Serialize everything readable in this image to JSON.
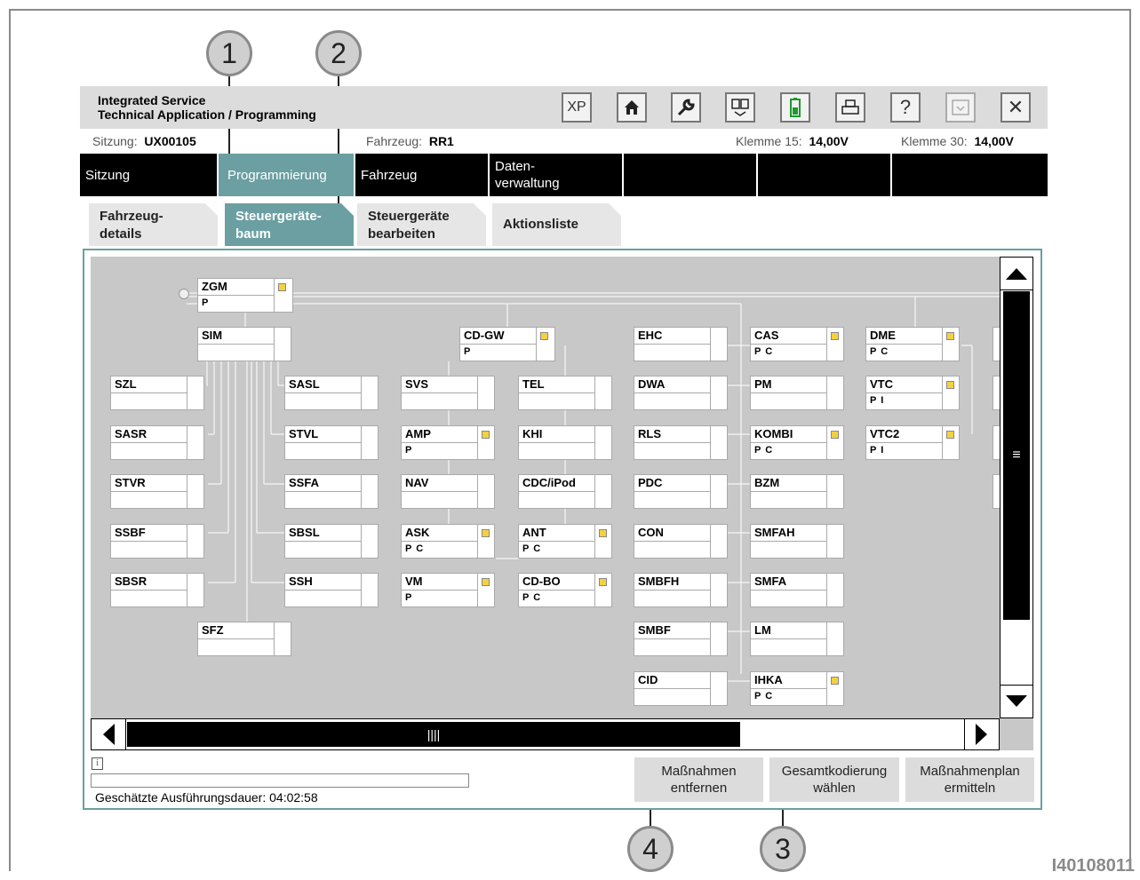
{
  "callouts": [
    "1",
    "2",
    "3",
    "4"
  ],
  "figure_id": "I40108011",
  "app": {
    "title": "Integrated Service\nTechnical Application / Programming",
    "toolbar": [
      {
        "name": "xp-button",
        "label": "XP",
        "icon": "xp-text"
      },
      {
        "name": "home-button",
        "label": "",
        "icon": "home-icon"
      },
      {
        "name": "wrench-button",
        "label": "",
        "icon": "wrench-icon"
      },
      {
        "name": "vehicle-data-button",
        "label": "",
        "icon": "data-exchange-icon"
      },
      {
        "name": "battery-button",
        "label": "",
        "icon": "battery-icon"
      },
      {
        "name": "print-button",
        "label": "",
        "icon": "printer-icon"
      },
      {
        "name": "help-button",
        "label": "?",
        "icon": "help-icon"
      },
      {
        "name": "minimize-button",
        "label": "",
        "icon": "minimize-icon"
      },
      {
        "name": "close-button",
        "label": "✕",
        "icon": "close-icon"
      }
    ]
  },
  "infobar": {
    "session_label": "Sitzung:",
    "session_value": "UX00105",
    "vehicle_label": "Fahrzeug:",
    "vehicle_value": "RR1",
    "k15_label": "Klemme 15:",
    "k15_value": "14,00V",
    "k30_label": "Klemme 30:",
    "k30_value": "14,00V"
  },
  "main_nav": [
    "Sitzung",
    "Programmierung",
    "Fahrzeug",
    "Daten-\nverwaltung",
    "",
    "",
    ""
  ],
  "sub_tabs": [
    "Fahrzeug-\ndetails",
    "Steuergeräte-\nbaum",
    "Steuergeräte\nbearbeiten",
    "Aktionsliste"
  ],
  "ecus": {
    "zgm": {
      "name": "ZGM",
      "action": "P"
    },
    "sim": {
      "name": "SIM",
      "action": ""
    },
    "szl": {
      "name": "SZL",
      "action": ""
    },
    "sasr": {
      "name": "SASR",
      "action": ""
    },
    "stvr": {
      "name": "STVR",
      "action": ""
    },
    "ssbf": {
      "name": "SSBF",
      "action": ""
    },
    "sbsr": {
      "name": "SBSR",
      "action": ""
    },
    "sfz": {
      "name": "SFZ",
      "action": ""
    },
    "sasl": {
      "name": "SASL",
      "action": ""
    },
    "stvl": {
      "name": "STVL",
      "action": ""
    },
    "ssfa": {
      "name": "SSFA",
      "action": ""
    },
    "sbsl": {
      "name": "SBSL",
      "action": ""
    },
    "ssh": {
      "name": "SSH",
      "action": ""
    },
    "cdgw": {
      "name": "CD-GW",
      "action": "P"
    },
    "svs": {
      "name": "SVS",
      "action": ""
    },
    "amp": {
      "name": "AMP",
      "action": "P"
    },
    "nav": {
      "name": "NAV",
      "action": ""
    },
    "ask": {
      "name": "ASK",
      "action": "P C"
    },
    "vm": {
      "name": "VM",
      "action": "P"
    },
    "tel": {
      "name": "TEL",
      "action": ""
    },
    "khi": {
      "name": "KHI",
      "action": ""
    },
    "cdcipod": {
      "name": "CDC/iPod",
      "action": ""
    },
    "ant": {
      "name": "ANT",
      "action": "P C"
    },
    "cdbo": {
      "name": "CD-BO",
      "action": "P C"
    },
    "ehc": {
      "name": "EHC",
      "action": ""
    },
    "dwa": {
      "name": "DWA",
      "action": ""
    },
    "rls": {
      "name": "RLS",
      "action": ""
    },
    "pdc": {
      "name": "PDC",
      "action": ""
    },
    "con": {
      "name": "CON",
      "action": ""
    },
    "smbfh": {
      "name": "SMBFH",
      "action": ""
    },
    "smbf": {
      "name": "SMBF",
      "action": ""
    },
    "cid": {
      "name": "CID",
      "action": ""
    },
    "cas": {
      "name": "CAS",
      "action": "P C"
    },
    "pm": {
      "name": "PM",
      "action": ""
    },
    "kombi": {
      "name": "KOMBI",
      "action": "P C"
    },
    "bzm": {
      "name": "BZM",
      "action": ""
    },
    "smfah": {
      "name": "SMFAH",
      "action": ""
    },
    "smfa": {
      "name": "SMFA",
      "action": ""
    },
    "lm": {
      "name": "LM",
      "action": ""
    },
    "ihka": {
      "name": "IHKA",
      "action": "P C"
    },
    "dme": {
      "name": "DME",
      "action": "P C"
    },
    "vtc": {
      "name": "VTC",
      "action": "P I"
    },
    "vtc2": {
      "name": "VTC2",
      "action": "P I"
    }
  },
  "footer": {
    "duration_text": "Geschätzte Ausführungsdauer: 04:02:58",
    "buttons": [
      "Maßnahmen\nentfernen",
      "Gesamtkodierung\nwählen",
      "Maßnahmenplan\nermitteln"
    ]
  },
  "colors": {
    "accent": "#6b9fa1",
    "nav_bg": "#000000",
    "tree_bg": "#c8c8c8",
    "marker": "#f5d040"
  }
}
